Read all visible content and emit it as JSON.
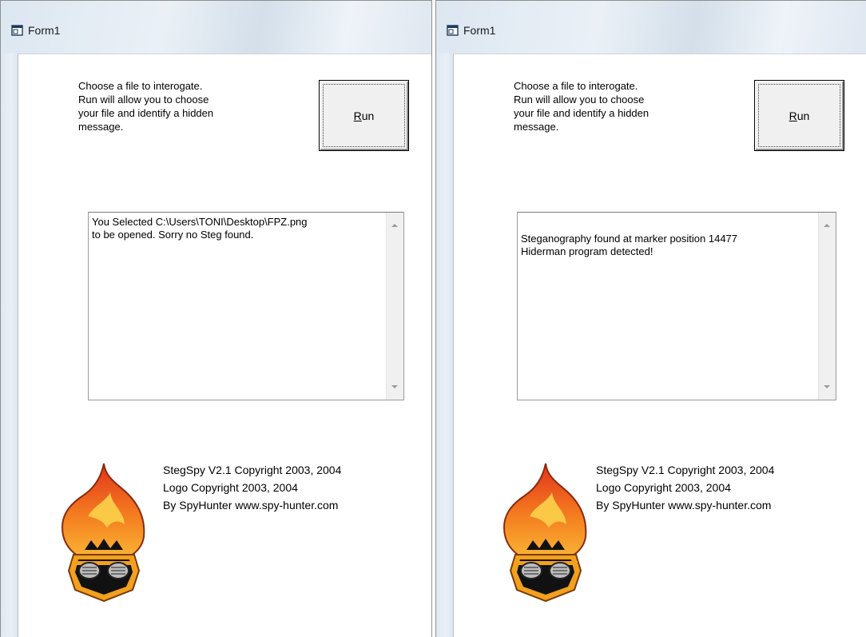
{
  "windows": [
    {
      "title": "Form1",
      "instructions": "Choose a file to interogate.\nRun will allow you to choose\nyour file and identify a hidden\nmessage.",
      "run_button": {
        "mnemonic": "R",
        "rest": "un"
      },
      "output_text": "You Selected C:\\Users\\TONI\\Desktop\\FPZ.png\nto be opened. Sorry no Steg found.",
      "credits": {
        "line1": "StegSpy V2.1 Copyright 2003, 2004",
        "line2": "Logo Copyright 2003, 2004",
        "line3": "By SpyHunter www.spy-hunter.com"
      }
    },
    {
      "title": "Form1",
      "instructions": "Choose a file to interogate.\nRun will allow you to choose\nyour file and identify a hidden\nmessage.",
      "run_button": {
        "mnemonic": "R",
        "rest": "un"
      },
      "output_text": "Steganography found at marker position 14477\nHiderman program detected!",
      "credits": {
        "line1": "StegSpy V2.1 Copyright 2003, 2004",
        "line2": "Logo Copyright 2003, 2004",
        "line3": "By SpyHunter www.spy-hunter.com"
      }
    }
  ],
  "icons": {
    "title_icon": "form-window-icon",
    "logo": "spyhunter-flame-logo-icon",
    "scroll_up": "scroll-up-arrow-icon",
    "scroll_down": "scroll-down-arrow-icon"
  },
  "colors": {
    "titlebar": "#dde7f1",
    "button_face": "#f0f0f0",
    "flame_orange": "#f28a1e",
    "flame_red": "#d9381e"
  }
}
